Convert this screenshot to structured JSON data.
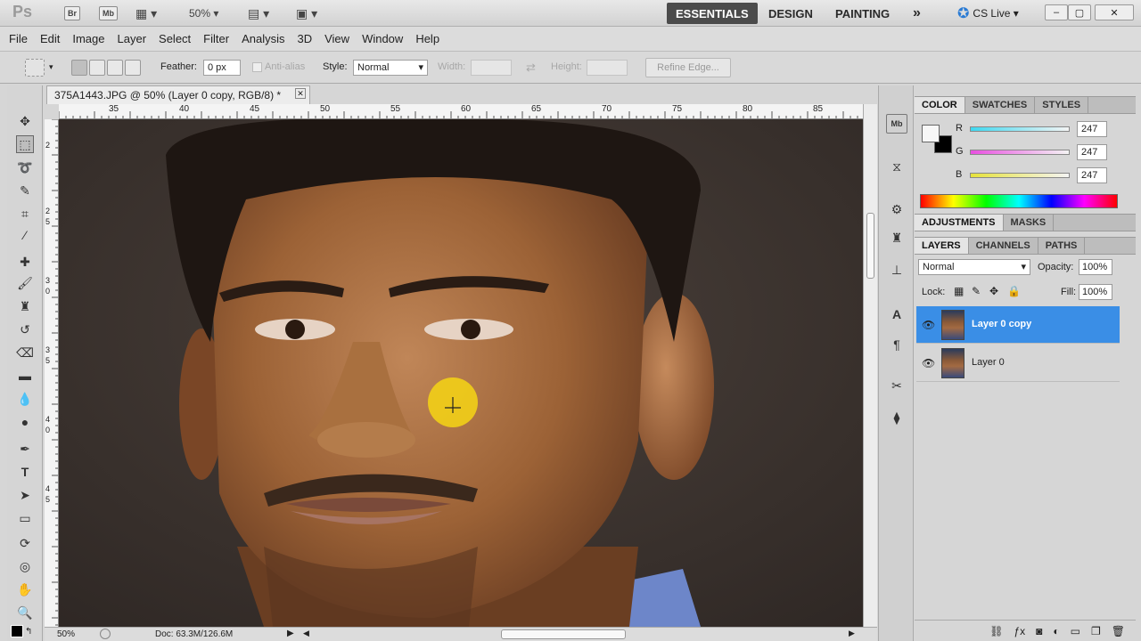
{
  "appbar": {
    "logo": "Ps",
    "bridge": "Br",
    "minibridge": "Mb",
    "zoom": "50%",
    "workspaces": [
      "ESSENTIALS",
      "DESIGN",
      "PAINTING"
    ],
    "more": "»",
    "cslive": "CS Live"
  },
  "menu": [
    "File",
    "Edit",
    "Image",
    "Layer",
    "Select",
    "Filter",
    "Analysis",
    "3D",
    "View",
    "Window",
    "Help"
  ],
  "options": {
    "feather_label": "Feather:",
    "feather_value": "0 px",
    "antialias_label": "Anti-alias",
    "style_label": "Style:",
    "style_value": "Normal",
    "width_label": "Width:",
    "height_label": "Height:",
    "refine_label": "Refine Edge..."
  },
  "document": {
    "tab_title": "375A1443.JPG @ 50% (Layer 0 copy, RGB/8) *",
    "ruler_top": [
      "35",
      "40",
      "45",
      "50",
      "55",
      "60",
      "65",
      "70",
      "75",
      "80",
      "85"
    ],
    "ruler_left": [
      "2",
      "2",
      "5",
      "3",
      "0",
      "3",
      "5",
      "4",
      "0",
      "4",
      "5"
    ],
    "zoom": "50%",
    "doc_info": "Doc: 63.3M/126.6M"
  },
  "color_panel": {
    "tabs": [
      "COLOR",
      "SWATCHES",
      "STYLES"
    ],
    "channels": [
      {
        "label": "R",
        "value": "247"
      },
      {
        "label": "G",
        "value": "247"
      },
      {
        "label": "B",
        "value": "247"
      }
    ]
  },
  "adjust_tabs": [
    "ADJUSTMENTS",
    "MASKS"
  ],
  "layers_panel": {
    "tabs": [
      "LAYERS",
      "CHANNELS",
      "PATHS"
    ],
    "blend_mode": "Normal",
    "opacity_label": "Opacity:",
    "opacity_value": "100%",
    "lock_label": "Lock:",
    "fill_label": "Fill:",
    "fill_value": "100%",
    "layers": [
      {
        "name": "Layer 0 copy",
        "selected": true
      },
      {
        "name": "Layer 0",
        "selected": false
      }
    ]
  },
  "colors": {
    "accent": "#3a8ee6",
    "workspace_active": "#4b4b4b"
  }
}
